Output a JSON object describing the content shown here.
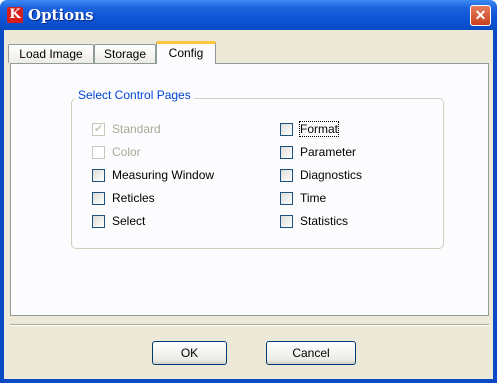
{
  "window": {
    "title": "Options",
    "icon_letter": "K"
  },
  "tabs": [
    {
      "label": "Load Image",
      "active": false
    },
    {
      "label": "Storage",
      "active": false
    },
    {
      "label": "Config",
      "active": true
    }
  ],
  "group": {
    "title": "Select Control Pages",
    "left_items": [
      {
        "label": "Standard",
        "checked": true,
        "enabled": false
      },
      {
        "label": "Color",
        "checked": false,
        "enabled": false
      },
      {
        "label": "Measuring Window",
        "checked": false,
        "enabled": true
      },
      {
        "label": "Reticles",
        "checked": false,
        "enabled": true
      },
      {
        "label": "Select",
        "checked": false,
        "enabled": true
      }
    ],
    "right_items": [
      {
        "label": "Format",
        "checked": false,
        "enabled": true,
        "focused": true
      },
      {
        "label": "Parameter",
        "checked": false,
        "enabled": true
      },
      {
        "label": "Diagnostics",
        "checked": false,
        "enabled": true
      },
      {
        "label": "Time",
        "checked": false,
        "enabled": true
      },
      {
        "label": "Statistics",
        "checked": false,
        "enabled": true
      }
    ]
  },
  "buttons": {
    "ok": "OK",
    "cancel": "Cancel"
  },
  "colors": {
    "titlebar": "#0a4ac4",
    "group_title": "#0046d5",
    "active_tab_accent": "#ffc83c",
    "close_button": "#c8401f"
  }
}
